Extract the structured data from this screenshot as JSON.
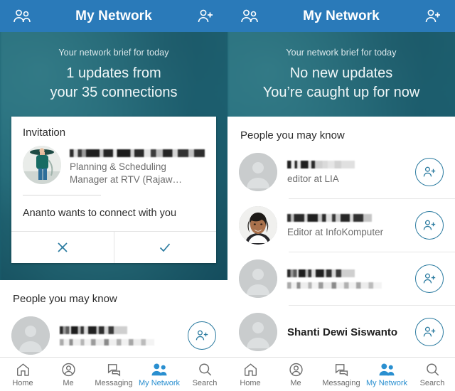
{
  "app": {
    "brand_blue": "#2a7ab9",
    "accent_blue": "#2b7ba0",
    "active_nav_blue": "#2a8fd0",
    "backdrop_teal": "#1a5f72"
  },
  "screens": [
    {
      "id": "screen-with-invitation",
      "appbar": {
        "title": "My Network",
        "left_icon": "people-icon",
        "right_icon": "person-add-icon"
      },
      "brief": {
        "subtitle": "Your network brief for today",
        "line1": "1 updates from",
        "line2": "your 35 connections"
      },
      "invitation": {
        "heading": "Invitation",
        "name": "",
        "title_line1": "Planning & Scheduling",
        "title_line2": "Manager at RTV (Rajaw…",
        "message": "Ananto wants to connect with you",
        "decline_icon": "close-icon",
        "accept_icon": "check-icon"
      },
      "pymk": {
        "title": "People you may know",
        "rows": [
          {
            "name": "",
            "subtitle": "",
            "avatar": "placeholder-avatar",
            "connect_icon": "person-add-icon"
          }
        ]
      }
    },
    {
      "id": "screen-caught-up",
      "appbar": {
        "title": "My Network",
        "left_icon": "people-icon",
        "right_icon": "person-add-icon"
      },
      "brief": {
        "subtitle": "Your network brief for today",
        "line1": "No new updates",
        "line2": "You’re caught up for now"
      },
      "pymk": {
        "title": "People you may know",
        "rows": [
          {
            "name": "",
            "subtitle": "editor at LIA",
            "avatar": "placeholder-avatar",
            "connect_icon": "person-add-icon"
          },
          {
            "name": "",
            "subtitle": "Editor at InfoKomputer",
            "avatar": "photo-avatar",
            "connect_icon": "person-add-icon"
          },
          {
            "name": "",
            "subtitle": "",
            "avatar": "placeholder-avatar",
            "connect_icon": "person-add-icon"
          },
          {
            "name": "Shanti Dewi Siswanto",
            "subtitle": "",
            "avatar": "placeholder-avatar",
            "connect_icon": "person-add-icon"
          }
        ]
      }
    }
  ],
  "bottom_nav": {
    "items": [
      {
        "label": "Home",
        "icon": "home-icon",
        "active": false
      },
      {
        "label": "Me",
        "icon": "person-circle-icon",
        "active": false
      },
      {
        "label": "Messaging",
        "icon": "chat-bubbles-icon",
        "active": false
      },
      {
        "label": "My Network",
        "icon": "people-icon",
        "active": true
      },
      {
        "label": "Search",
        "icon": "search-icon",
        "active": false
      }
    ]
  }
}
